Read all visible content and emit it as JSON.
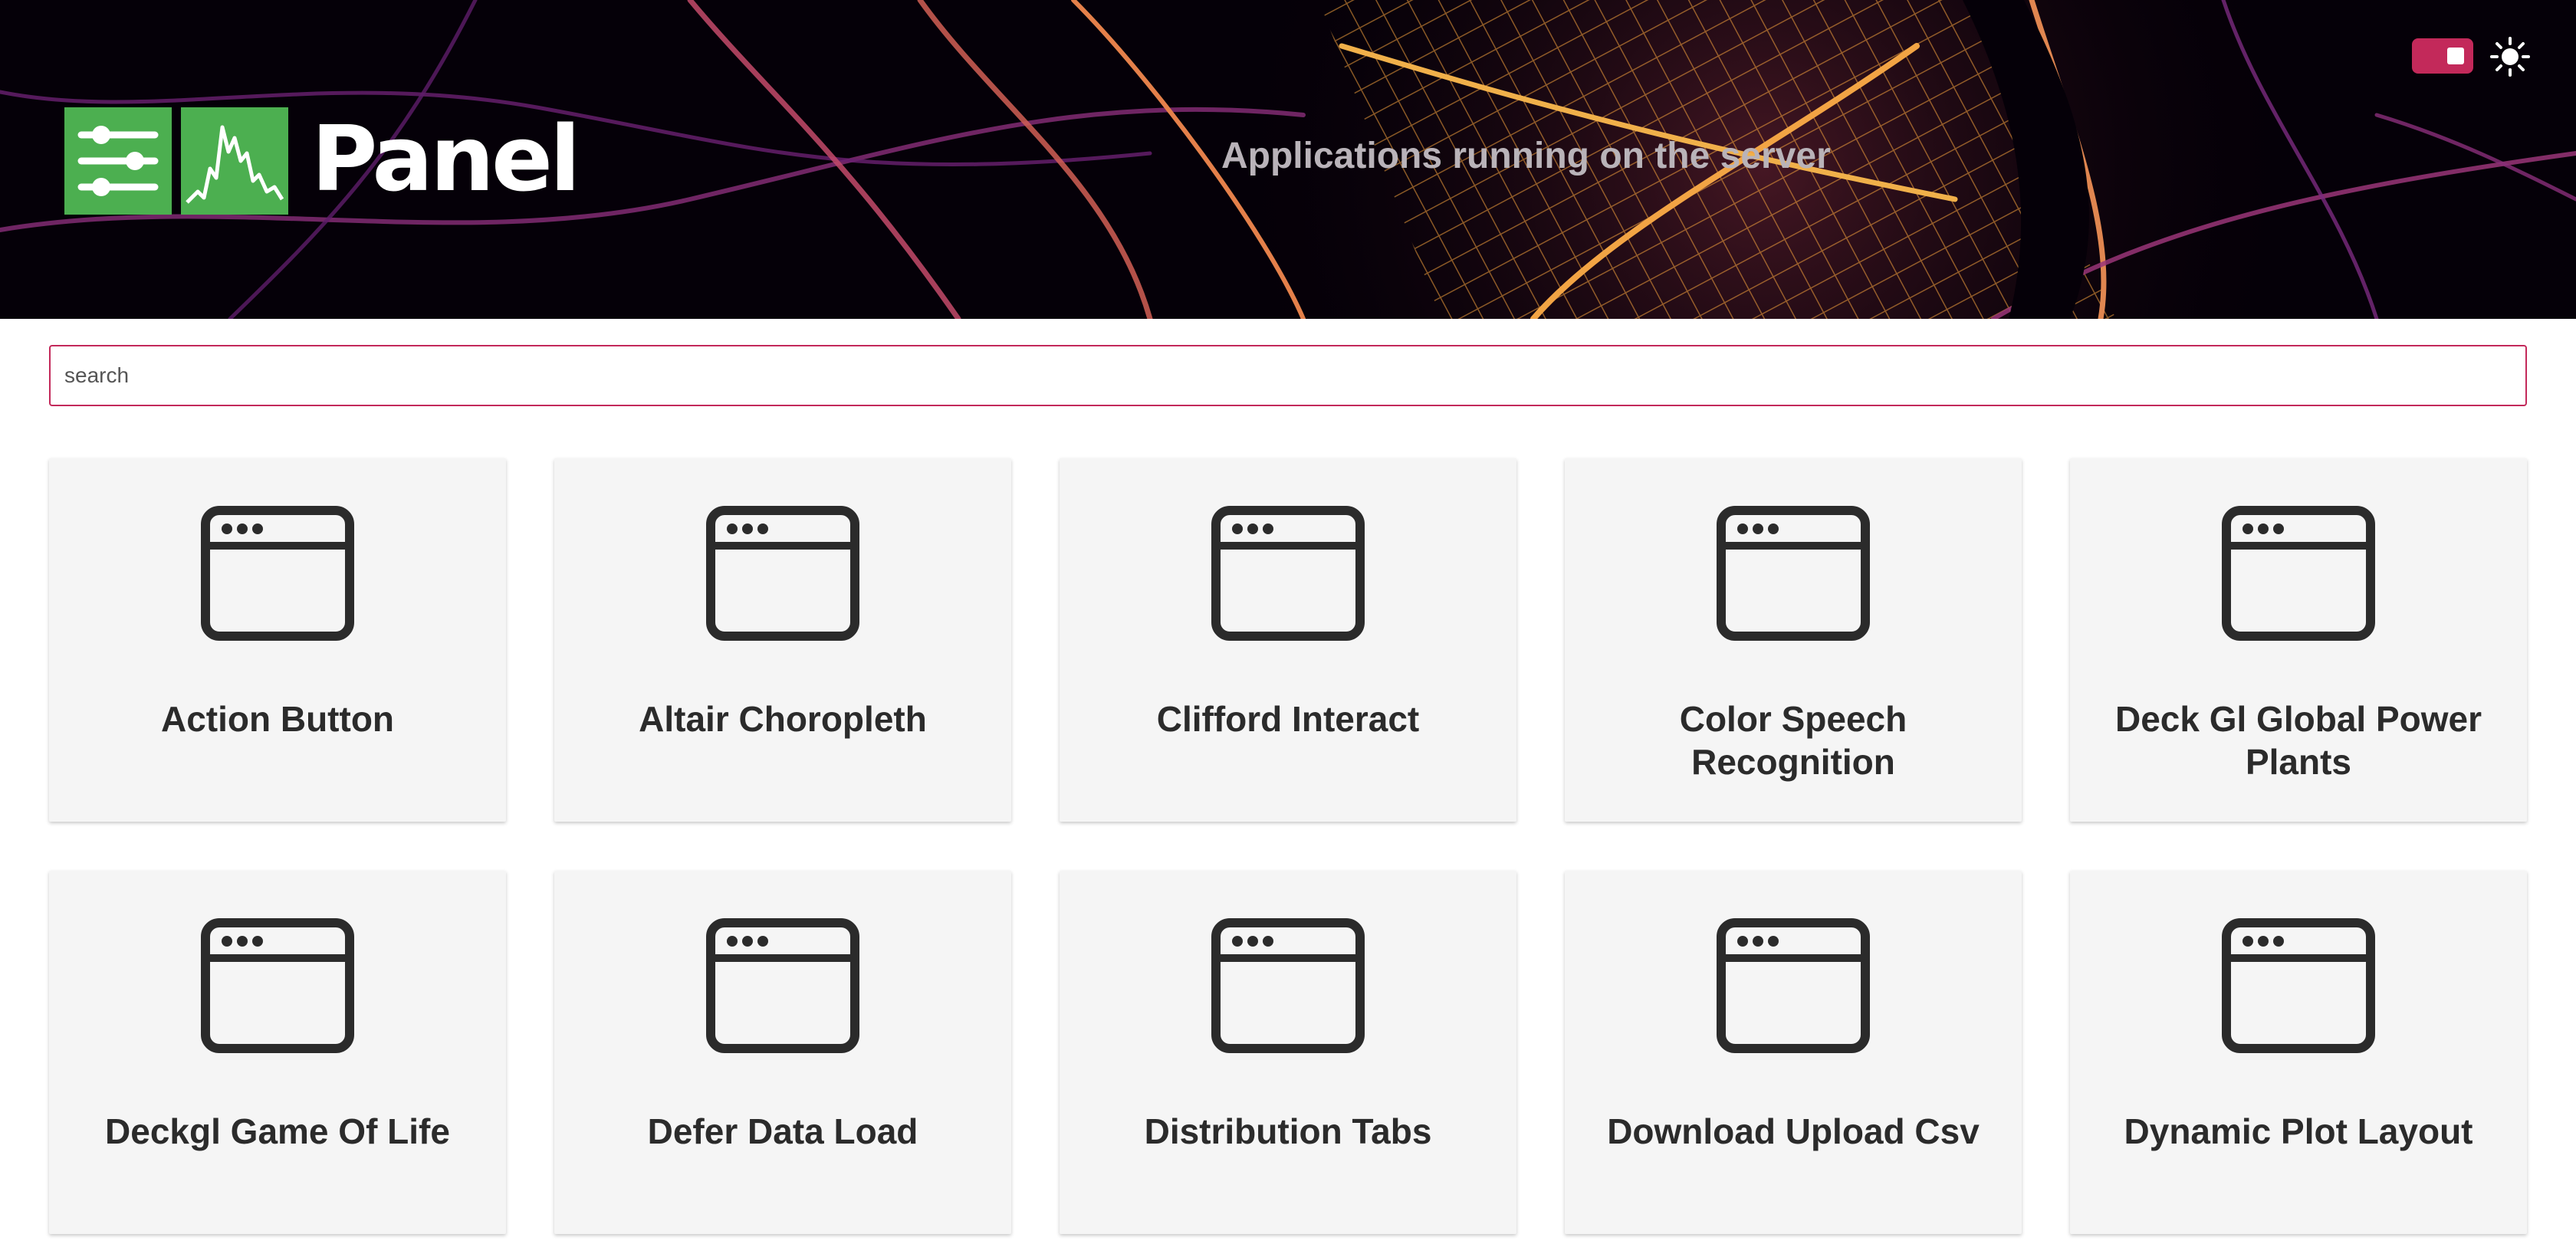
{
  "header": {
    "logo_text": "Panel",
    "title": "Applications running on the server",
    "theme_toggle_state": "on",
    "accent_color": "#c3295a",
    "logo_color": "#4caf50",
    "icons": [
      "sliders-icon",
      "line-chart-icon",
      "sun-icon"
    ]
  },
  "search": {
    "placeholder": "search",
    "value": ""
  },
  "apps": [
    {
      "title": "Action Button",
      "icon": "app-window-icon"
    },
    {
      "title": "Altair Choropleth",
      "icon": "app-window-icon"
    },
    {
      "title": "Clifford Interact",
      "icon": "app-window-icon"
    },
    {
      "title": "Color Speech Recognition",
      "icon": "app-window-icon"
    },
    {
      "title": "Deck Gl Global Power Plants",
      "icon": "app-window-icon"
    },
    {
      "title": "Deckgl Game Of Life",
      "icon": "app-window-icon"
    },
    {
      "title": "Defer Data Load",
      "icon": "app-window-icon"
    },
    {
      "title": "Distribution Tabs",
      "icon": "app-window-icon"
    },
    {
      "title": "Download Upload Csv",
      "icon": "app-window-icon"
    },
    {
      "title": "Dynamic Plot Layout",
      "icon": "app-window-icon"
    }
  ]
}
